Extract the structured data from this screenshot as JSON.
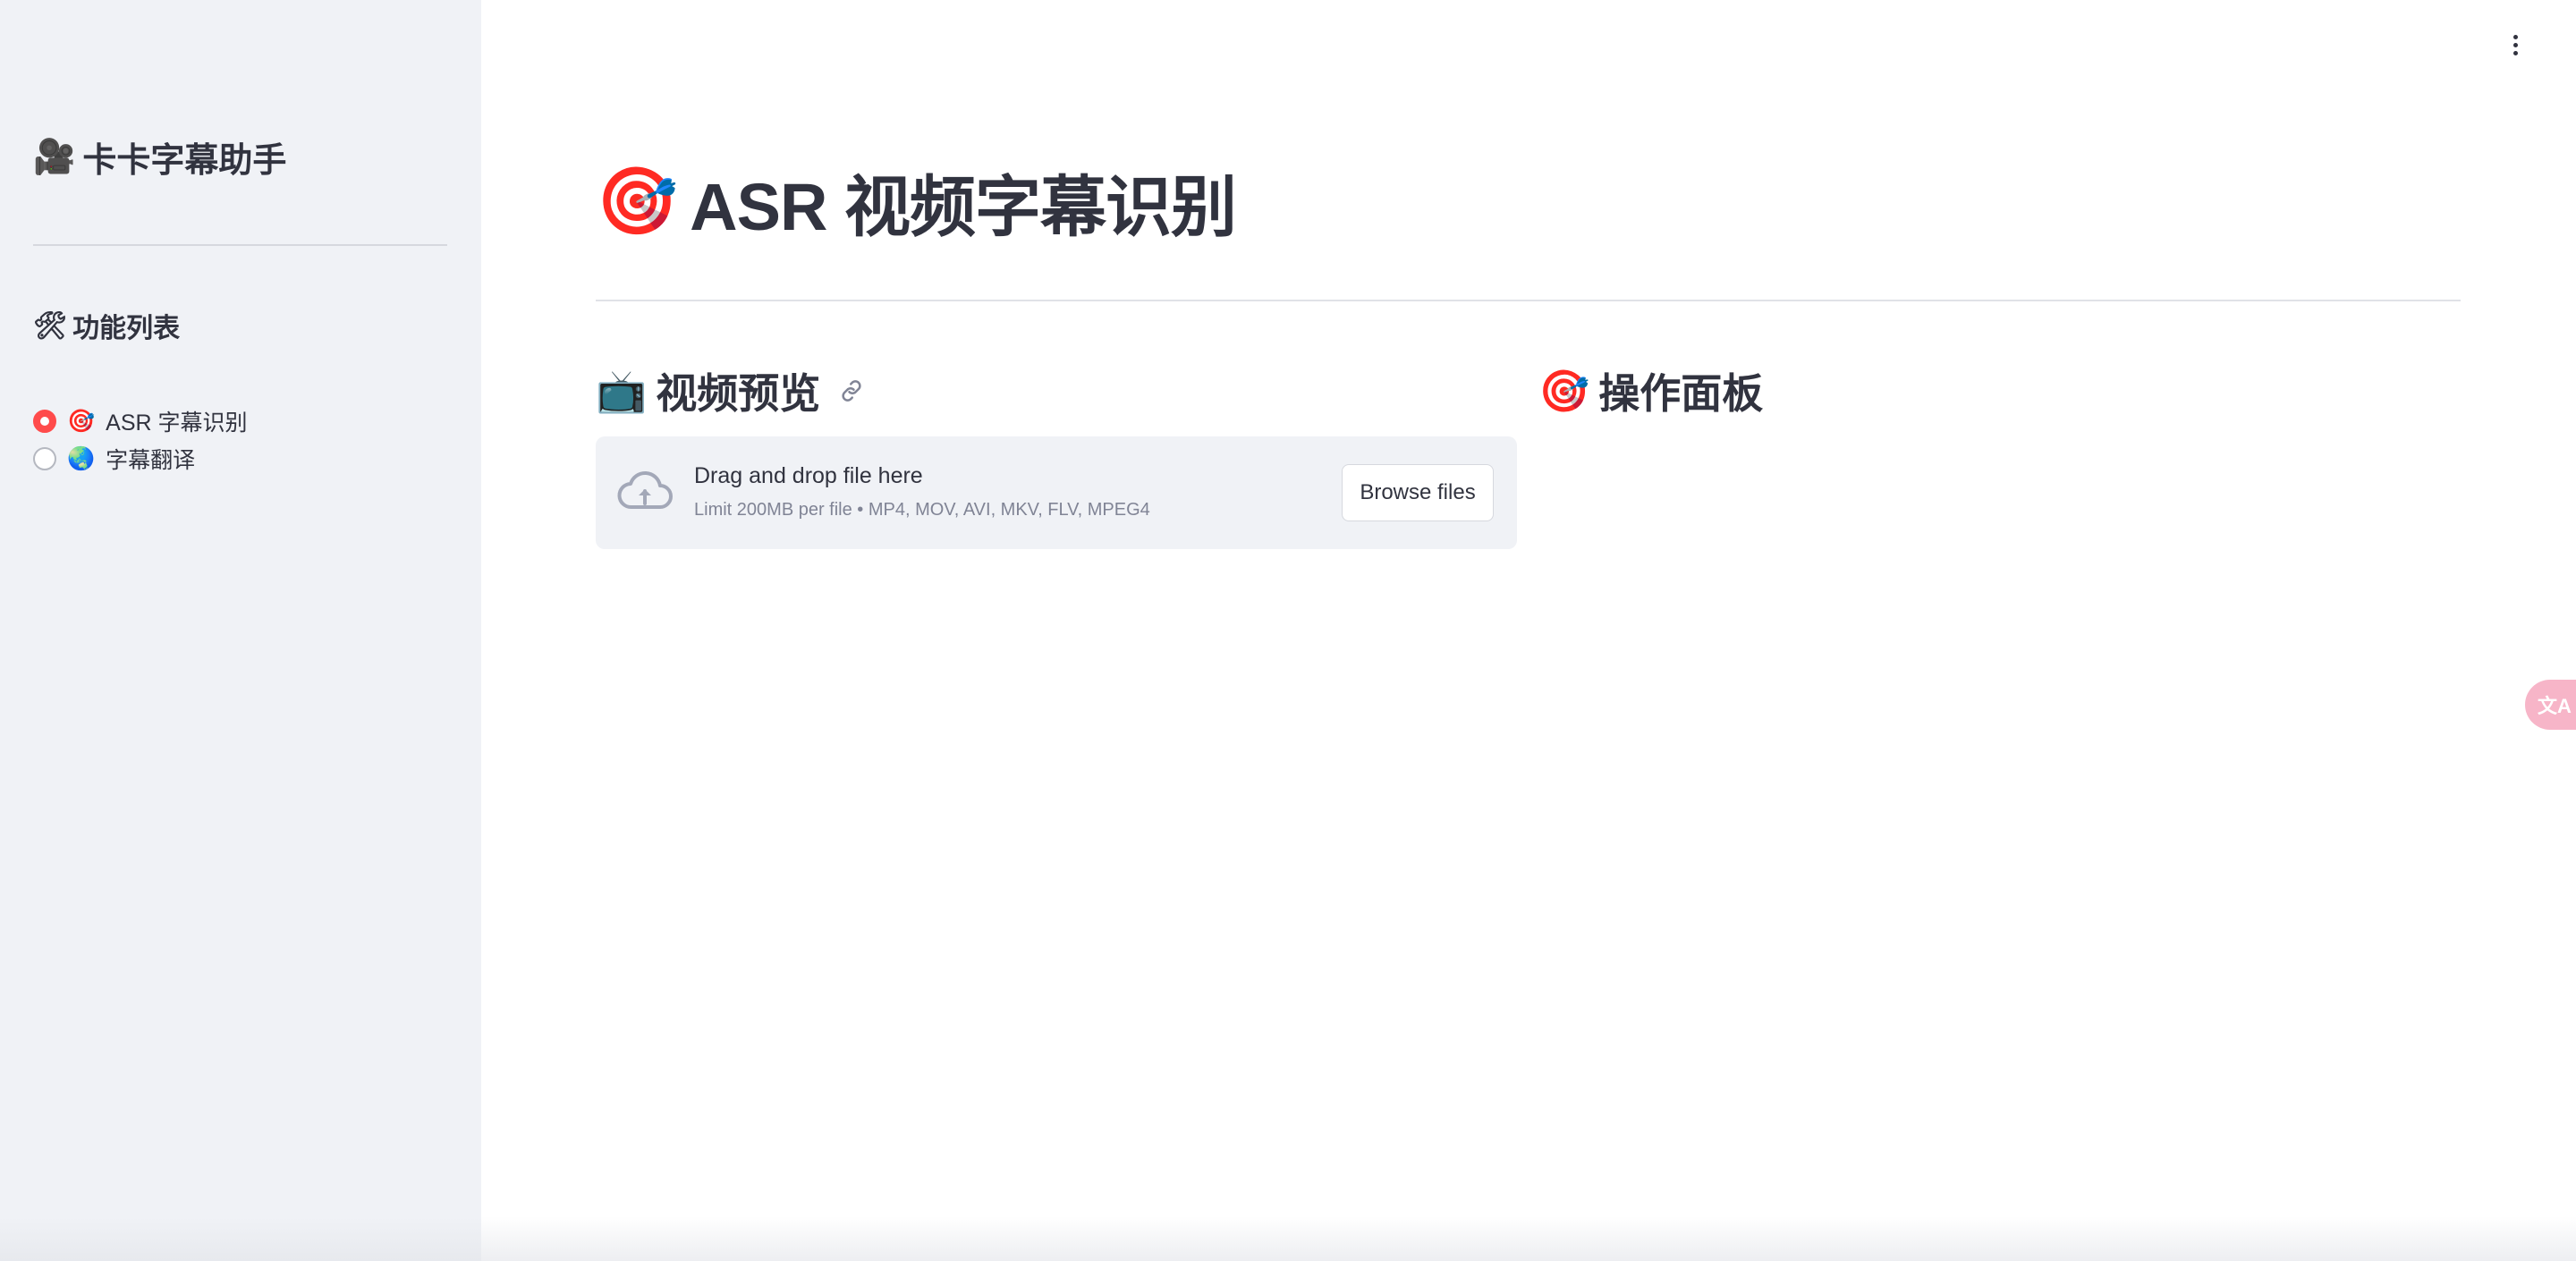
{
  "sidebar": {
    "title_icon": "🎥",
    "title": "卡卡字幕助手",
    "section_icon": "🛠",
    "section_title": "功能列表",
    "items": [
      {
        "icon": "🎯",
        "label": "ASR 字幕识别",
        "selected": true
      },
      {
        "icon": "🌏",
        "label": "字幕翻译",
        "selected": false
      }
    ]
  },
  "main": {
    "title_icon": "🎯",
    "title": "ASR 视频字幕识别",
    "left_header_icon": "📺",
    "left_header": "视频预览",
    "right_header_icon": "🎯",
    "right_header": "操作面板",
    "uploader": {
      "main_text": "Drag and drop file here",
      "sub_text": "Limit 200MB per file • MP4, MOV, AVI, MKV, FLV, MPEG4",
      "button_label": "Browse files"
    }
  },
  "floating": {
    "translate_label": "文A"
  },
  "colors": {
    "accent": "#ff4b4b",
    "sidebar_bg": "#f0f2f6",
    "text": "#31333f"
  }
}
